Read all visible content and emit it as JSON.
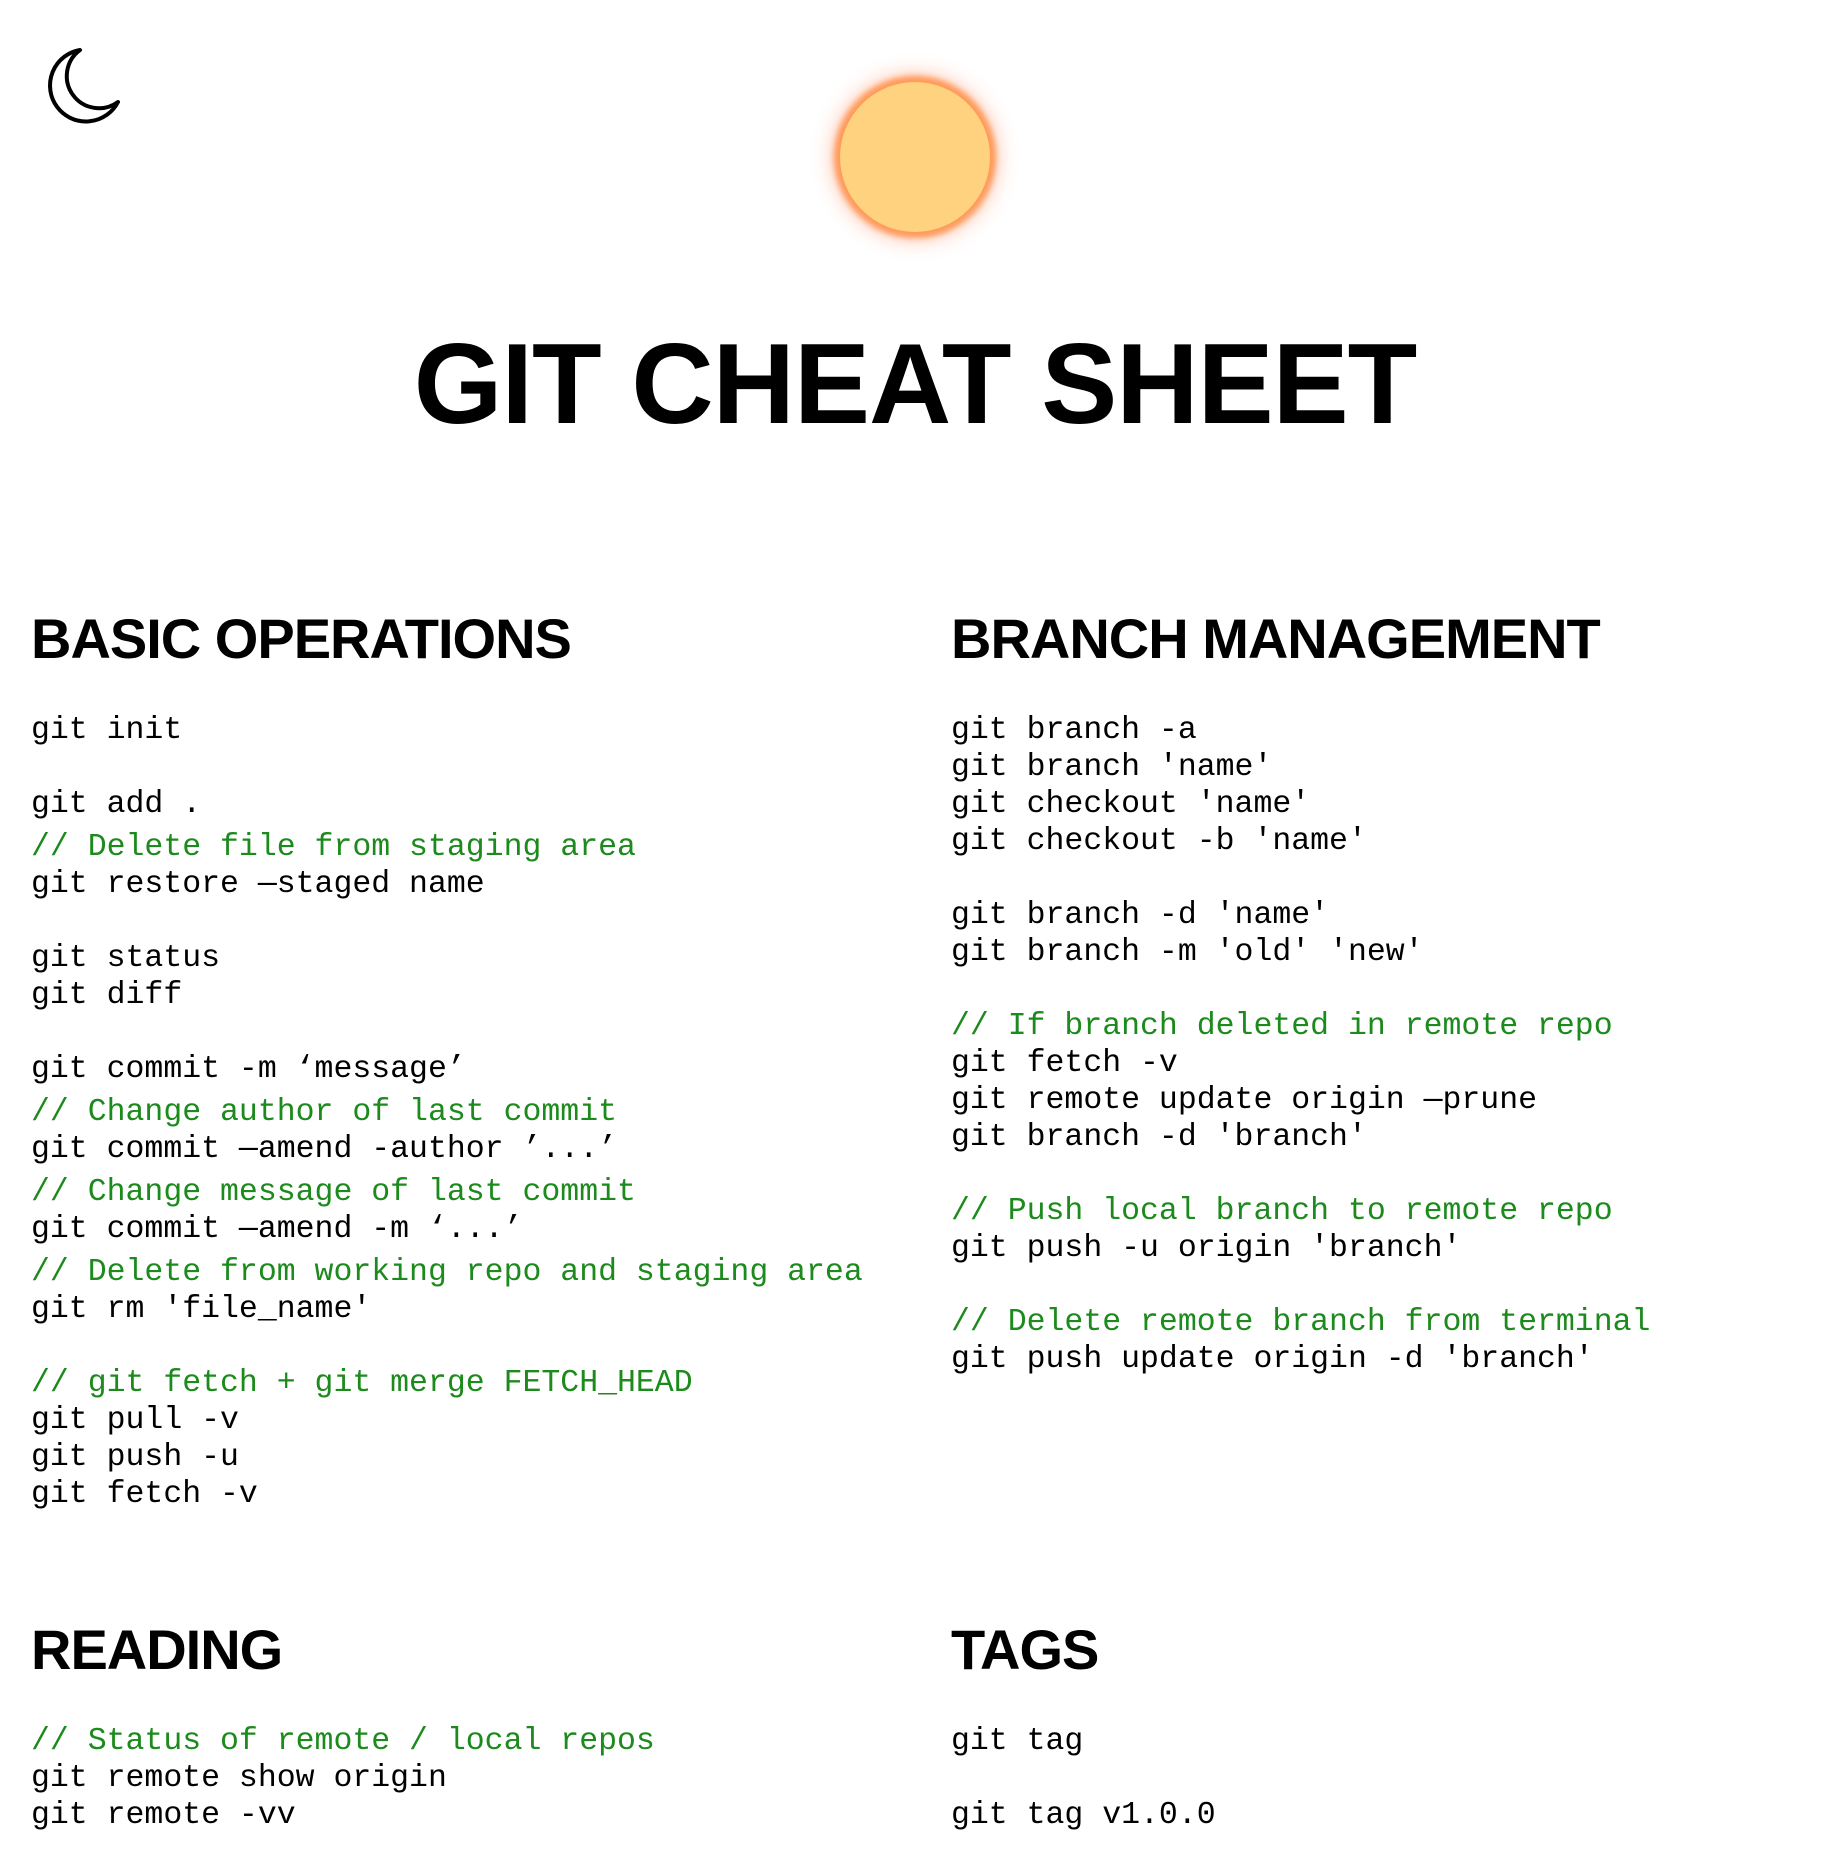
{
  "header": {
    "theme_toggle_icon": "moon-icon",
    "sun_icon": "sun-icon",
    "sun_color": "#ffd27f",
    "title": "GIT CHEAT SHEET"
  },
  "colors": {
    "comment": "#1c8a1c",
    "command": "#000000"
  },
  "sections": {
    "basic": {
      "heading": "BASIC OPERATIONS",
      "groups": [
        [
          {
            "type": "cmd",
            "text": "git init"
          }
        ],
        [
          {
            "type": "cmd",
            "text": "git add ."
          },
          {
            "type": "comment",
            "text": "// Delete file from staging area"
          },
          {
            "type": "cmd",
            "text": "git restore —staged name"
          }
        ],
        [
          {
            "type": "cmd",
            "text": "git status"
          },
          {
            "type": "cmd",
            "text": "git diff"
          }
        ],
        [
          {
            "type": "cmd",
            "text": "git commit -m ‘message’"
          },
          {
            "type": "comment",
            "text": "// Change author of last commit"
          },
          {
            "type": "cmd",
            "text": "git commit —amend -author ’...’"
          },
          {
            "type": "comment",
            "text": "// Change message of last commit"
          },
          {
            "type": "cmd",
            "text": "git commit —amend -m ‘...’"
          },
          {
            "type": "comment",
            "text": "// Delete from working repo and staging area"
          },
          {
            "type": "cmd",
            "text": "git rm 'file_name'"
          }
        ],
        [
          {
            "type": "comment",
            "text": "// git fetch + git merge FETCH_HEAD"
          },
          {
            "type": "cmd",
            "text": "git pull -v"
          },
          {
            "type": "cmd",
            "text": "git push -u"
          },
          {
            "type": "cmd",
            "text": "git fetch -v"
          }
        ]
      ]
    },
    "branch": {
      "heading": "BRANCH MANAGEMENT",
      "groups": [
        [
          {
            "type": "cmd",
            "text": "git branch -a"
          },
          {
            "type": "cmd",
            "text": "git branch 'name'"
          },
          {
            "type": "cmd",
            "text": "git checkout 'name'"
          },
          {
            "type": "cmd",
            "text": "git checkout -b 'name'"
          }
        ],
        [
          {
            "type": "cmd",
            "text": "git branch -d 'name'"
          },
          {
            "type": "cmd",
            "text": "git branch -m 'old' 'new'"
          }
        ],
        [
          {
            "type": "comment",
            "text": "// If branch deleted in remote repo"
          },
          {
            "type": "cmd",
            "text": "git fetch -v"
          },
          {
            "type": "cmd",
            "text": "git remote update origin —prune"
          },
          {
            "type": "cmd",
            "text": "git branch -d 'branch'"
          }
        ],
        [
          {
            "type": "comment",
            "text": "// Push local branch to remote repo"
          },
          {
            "type": "cmd",
            "text": "git push -u origin 'branch'"
          }
        ],
        [
          {
            "type": "comment",
            "text": "// Delete remote branch from terminal"
          },
          {
            "type": "cmd",
            "text": "git push update origin -d 'branch'"
          }
        ]
      ]
    },
    "reading": {
      "heading": "READING",
      "groups": [
        [
          {
            "type": "comment",
            "text": "// Status of remote / local repos"
          },
          {
            "type": "cmd",
            "text": "git remote show origin"
          },
          {
            "type": "cmd",
            "text": "git remote -vv"
          }
        ]
      ]
    },
    "tags": {
      "heading": "TAGS",
      "groups": [
        [
          {
            "type": "cmd",
            "text": "git tag"
          }
        ],
        [
          {
            "type": "cmd",
            "text": "git tag v1.0.0"
          }
        ]
      ]
    }
  }
}
